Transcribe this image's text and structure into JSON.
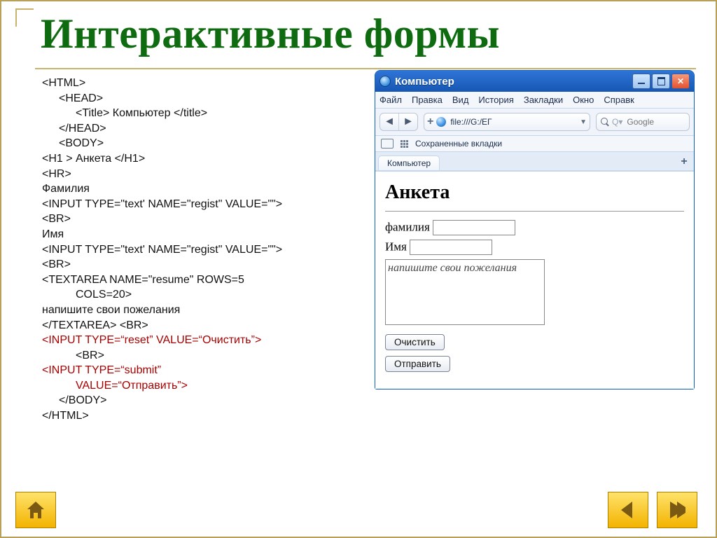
{
  "title": "Интерактивные формы",
  "code": {
    "lines": [
      {
        "t": "<HTML>",
        "cls": ""
      },
      {
        "t": "<HEAD>",
        "cls": "i1"
      },
      {
        "t": "<Title> Компьютер </title>",
        "cls": "i2"
      },
      {
        "t": "</HEAD>",
        "cls": "i1"
      },
      {
        "t": "<BODY>",
        "cls": "i1"
      },
      {
        "t": "<H1 > Анкета </H1>",
        "cls": ""
      },
      {
        "t": "<HR>",
        "cls": ""
      },
      {
        "t": "Фамилия",
        "cls": ""
      },
      {
        "t": "<INPUT TYPE=\"text' NAME=\"regist\" VALUE=\"\">",
        "cls": ""
      },
      {
        "t": "<BR>",
        "cls": ""
      },
      {
        "t": "Имя",
        "cls": ""
      },
      {
        "t": "<INPUT TYPE=\"text' NAME=\"regist\" VALUE=\"\">",
        "cls": ""
      },
      {
        "t": "<BR>",
        "cls": ""
      },
      {
        "t": "<TEXTAREA NAME=\"resume\" ROWS=5",
        "cls": ""
      },
      {
        "t": "COLS=20>",
        "cls": "i2"
      },
      {
        "t": "напишите свои пожелания",
        "cls": ""
      },
      {
        "t": "</TEXTAREA> <BR>",
        "cls": ""
      },
      {
        "t": "<INPUT TYPE=“reset” VALUE=“Очистить”>",
        "cls": "red"
      },
      {
        "t": "<BR>",
        "cls": "i2"
      },
      {
        "t": "<INPUT TYPE=“submit”",
        "cls": "red"
      },
      {
        "t": "VALUE=“Отправить”>",
        "cls": "red i2"
      },
      {
        "t": "",
        "cls": ""
      },
      {
        "t": "</BODY>",
        "cls": "i1"
      },
      {
        "t": "</HTML>",
        "cls": ""
      }
    ]
  },
  "browser": {
    "window_title": "Компьютер",
    "menus": [
      "Файл",
      "Правка",
      "Вид",
      "История",
      "Закладки",
      "Окно",
      "Справк"
    ],
    "url": "file:///G:/ЕГ",
    "search_placeholder": "Google",
    "bookbar_label": "Сохраненные вкладки",
    "tab_label": "Компьютер",
    "page": {
      "heading": "Анкета",
      "label_lastname": "фамилия",
      "label_firstname": "Имя",
      "textarea_text": "напишите свои пожелания",
      "btn_reset": "Очистить",
      "btn_submit": "Отправить"
    }
  }
}
